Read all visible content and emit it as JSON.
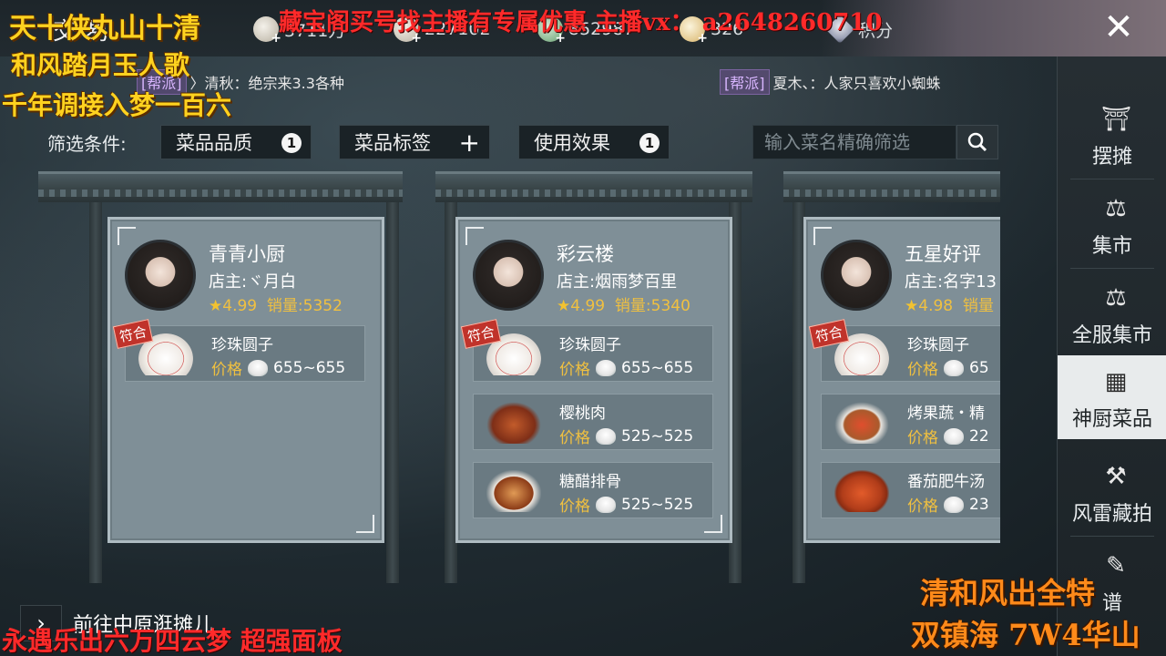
{
  "header": {
    "title": "交易",
    "close_icon": "close-icon",
    "currencies": [
      {
        "icon": "coin-icon",
        "value": "3711万"
      },
      {
        "icon": "silver-icon",
        "value": "227102"
      },
      {
        "icon": "jade-icon",
        "value": "852987"
      },
      {
        "icon": "gold-icon",
        "value": "326"
      },
      {
        "icon": "points-icon",
        "value": "积分"
      }
    ]
  },
  "chat": [
    {
      "tag": "[帮派]",
      "text": "〉清秋：绝宗来3.3各种"
    },
    {
      "tag": "[帮派]",
      "text": "夏木、：人家只喜欢小蜘蛛"
    }
  ],
  "filter": {
    "label": "筛选条件:",
    "buttons": [
      {
        "label": "菜品品质",
        "badge": "1"
      },
      {
        "label": "菜品标签",
        "badge": "+"
      },
      {
        "label": "使用效果",
        "badge": "1"
      }
    ],
    "search_placeholder": "输入菜名精确筛选"
  },
  "stalls": [
    {
      "name": "青青小厨",
      "owner": "店主:ヾ月白",
      "rating": "4.99",
      "sales": "销量:5352",
      "items": [
        {
          "name": "珍珠圆子",
          "price_label": "价格",
          "price": "655~655",
          "match": "符合"
        }
      ]
    },
    {
      "name": "彩云楼",
      "owner": "店主:烟雨梦百里",
      "rating": "4.99",
      "sales": "销量:5340",
      "items": [
        {
          "name": "珍珠圆子",
          "price_label": "价格",
          "price": "655~655",
          "match": "符合"
        },
        {
          "name": "樱桃肉",
          "price_label": "价格",
          "price": "525~525"
        },
        {
          "name": "糖醋排骨",
          "price_label": "价格",
          "price": "525~525"
        }
      ]
    },
    {
      "name": "五星好评",
      "owner": "店主:名字13",
      "rating": "4.98",
      "sales": "销量",
      "items": [
        {
          "name": "珍珠圆子",
          "price_label": "价格",
          "price": "65",
          "match": "符合"
        },
        {
          "name": "烤果蔬・精",
          "price_label": "价格",
          "price": "22"
        },
        {
          "name": "番茄肥牛汤",
          "price_label": "价格",
          "price": "23"
        }
      ]
    }
  ],
  "sidebar": [
    {
      "label": "摆摊",
      "icon": "stall-icon",
      "active": false
    },
    {
      "label": "集市",
      "icon": "market-icon",
      "active": false
    },
    {
      "label": "全服集市",
      "icon": "global-market-icon",
      "active": false
    },
    {
      "label": "神厨菜品",
      "icon": "chef-dish-icon",
      "active": true
    },
    {
      "label": "风雷藏拍",
      "icon": "auction-hammer-icon",
      "active": false
    },
    {
      "label": "谱",
      "icon": "recipe-icon",
      "active": false
    }
  ],
  "bottom_link": "前往中原逛摊儿",
  "overlays": {
    "top_left_1": "天十侠丸山十清",
    "top_left_2": "和风踏月玉人歌",
    "top_left_3": "千年调接入梦一百六",
    "top_center": "藏宝阁买号找主播有专属优惠 主播vx： a2648260710",
    "bottom_left": "永遇乐出六万四云梦 超强面板",
    "bottom_right_1": "清和风出全特",
    "bottom_right_2": "双镇海 7W4华山"
  }
}
